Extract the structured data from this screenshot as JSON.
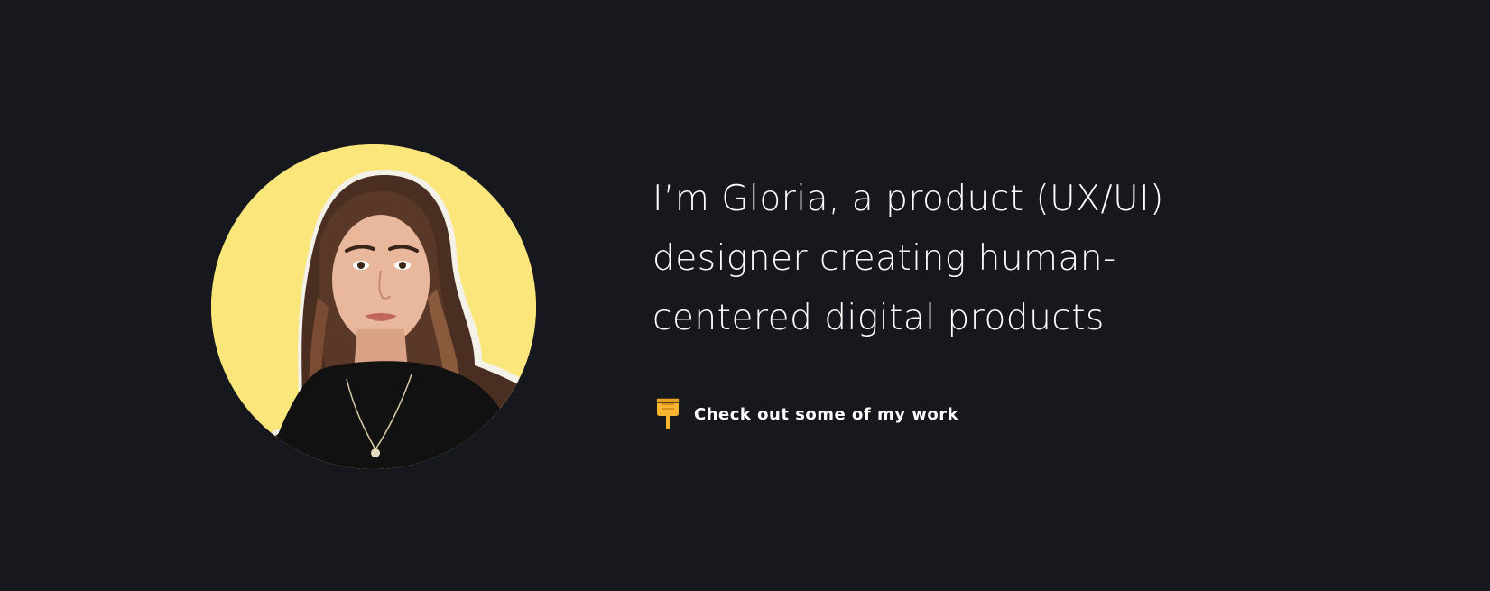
{
  "hero": {
    "headline_lines": [
      "I’m Gloria, a product (UX/UI)",
      "designer creating human-",
      "centered digital products"
    ],
    "cta": {
      "icon": "pointing-down-hand-icon",
      "label": "Check out some of my work"
    },
    "portrait": {
      "icon": "profile-photo",
      "background_color": "#fae67a"
    }
  },
  "colors": {
    "page_background": "#16181d",
    "text": "#ffffff",
    "accent_yellow": "#fae67a",
    "emoji_yellow": "#f7b530"
  }
}
